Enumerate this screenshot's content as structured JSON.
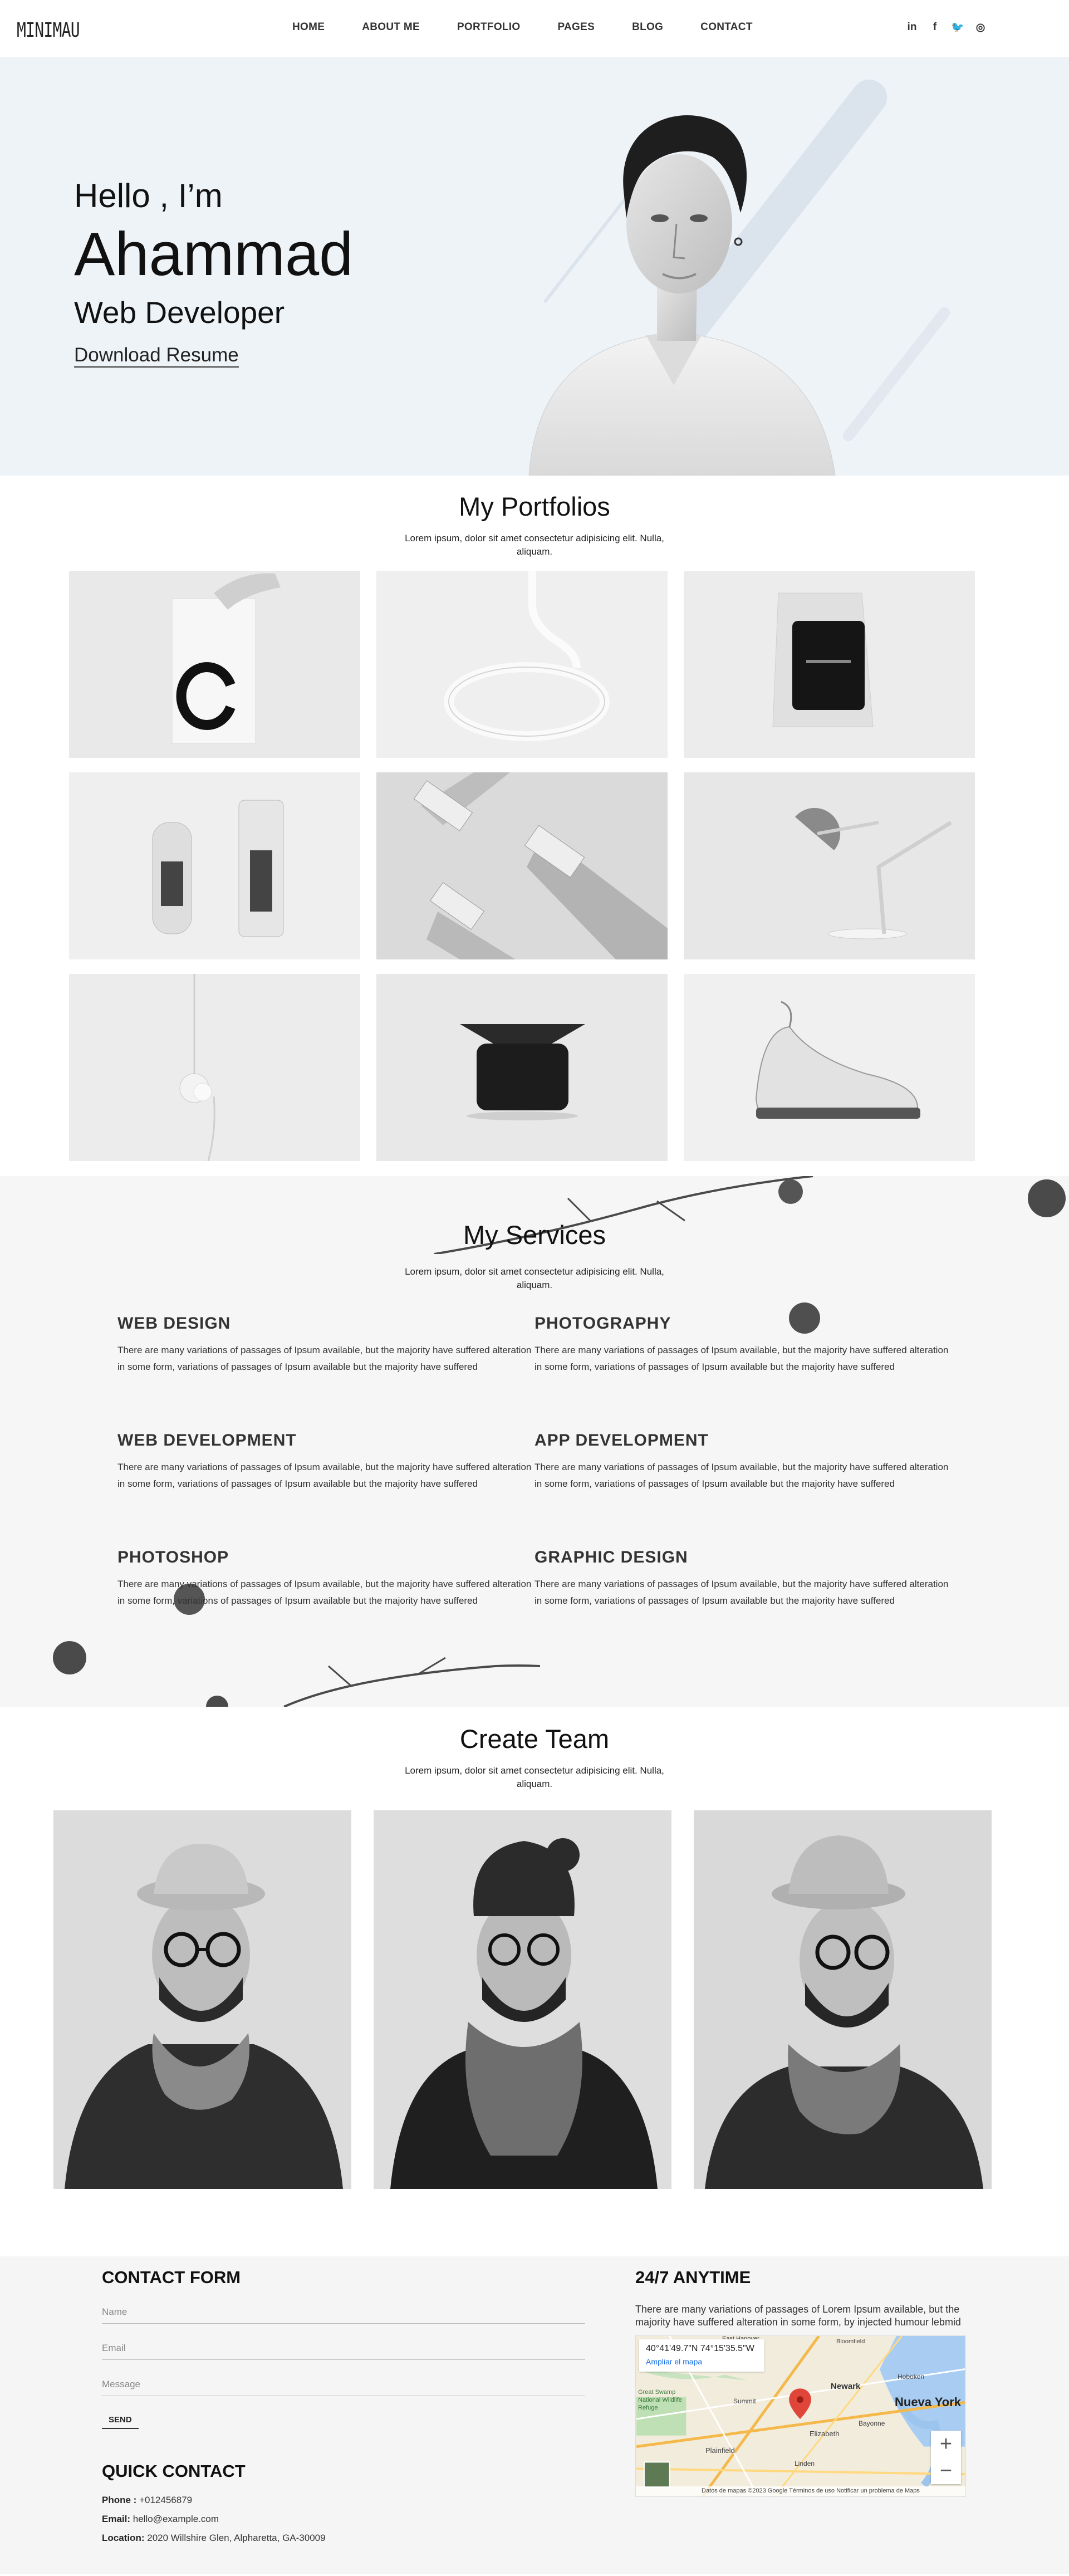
{
  "brand": {
    "logo": "MINIMAU"
  },
  "nav": {
    "items": [
      "HOME",
      "ABOUT ME",
      "PORTFOLIO",
      "PAGES",
      "BLOG",
      "CONTACT"
    ]
  },
  "socials": [
    {
      "name": "linkedin-icon",
      "glyph": "in"
    },
    {
      "name": "facebook-icon",
      "glyph": "f"
    },
    {
      "name": "twitter-icon",
      "glyph": "🐦"
    },
    {
      "name": "dribbble-icon",
      "glyph": "◎"
    }
  ],
  "hero": {
    "greeting": "Hello , I’m",
    "name": "Ahammad",
    "role": "Web Developer",
    "cta": "Download Resume"
  },
  "portfolio": {
    "title": "My Portfolios",
    "subtitle": "Lorem ipsum, dolor sit amet consectetur adipisicing elit. Nulla, aliquam.",
    "items": [
      "letter-c-poster",
      "ring-stand",
      "tshirt-bag",
      "cosmetic-bottles",
      "shaver-blocks",
      "desk-lamp",
      "pendant-lamp",
      "speaker-dock",
      "sneaker"
    ]
  },
  "services": {
    "title": "My Services",
    "subtitle": "Lorem ipsum, dolor sit amet consectetur adipisicing elit. Nulla, aliquam.",
    "items": [
      {
        "title": "WEB DESIGN",
        "text": "There are many variations of passages of Ipsum available, but the majority have suffered alteration in some form, variations of passages of Ipsum available but the majority have suffered"
      },
      {
        "title": "PHOTOGRAPHY",
        "text": "There are many variations of passages of Ipsum available, but the majority have suffered alteration in some form, variations of passages of Ipsum available but the majority have suffered"
      },
      {
        "title": "WEB DEVELOPMENT",
        "text": "There are many variations of passages of Ipsum available, but the majority have suffered alteration in some form, variations of passages of Ipsum available but the majority have suffered"
      },
      {
        "title": "APP DEVELOPMENT",
        "text": "There are many variations of passages of Ipsum available, but the majority have suffered alteration in some form, variations of passages of Ipsum available but the majority have suffered"
      },
      {
        "title": "PHOTOSHOP",
        "text": "There are many variations of passages of Ipsum available, but the majority have suffered alteration in some form, variations of passages of Ipsum available but the majority have suffered"
      },
      {
        "title": "GRAPHIC DESIGN",
        "text": "There are many variations of passages of Ipsum available, but the majority have suffered alteration in some form, variations of passages of Ipsum available but the majority have suffered"
      }
    ]
  },
  "team": {
    "title": "Create Team",
    "subtitle": "Lorem ipsum, dolor sit amet consectetur adipisicing elit. Nulla, aliquam."
  },
  "contact": {
    "form_title": "CONTACT FORM",
    "name_placeholder": "Name",
    "email_placeholder": "Email",
    "message_placeholder": "Message",
    "send_label": "SEND",
    "quick_title": "QUICK CONTACT",
    "phone_label": "Phone :",
    "phone": "+012456879",
    "email_label": "Email:",
    "email": "hello@example.com",
    "location_label": "Location:",
    "location": "2020 Willshire Glen, Alpharetta, GA-30009"
  },
  "anytime": {
    "title": "24/7 ANYTIME",
    "text": "There are many variations of passages of Lorem Ipsum available, but the majority have suffered alteration in some form, by injected humour lebmid",
    "map": {
      "coords": "40°41'49.7\"N 74°15'35.5\"W",
      "enlarge_link": "Ampliar el mapa",
      "footer": "Datos de mapas ©2023 Google    Términos de uso    Notificar un problema de Maps",
      "labels": [
        "Newark",
        "Nueva York",
        "Hoboken",
        "Elizabeth",
        "Bayonne",
        "Summit",
        "Plainfield",
        "Linden",
        "Great Swamp National Wildlife Refuge",
        "East Hanover",
        "Bloomfield"
      ]
    }
  }
}
